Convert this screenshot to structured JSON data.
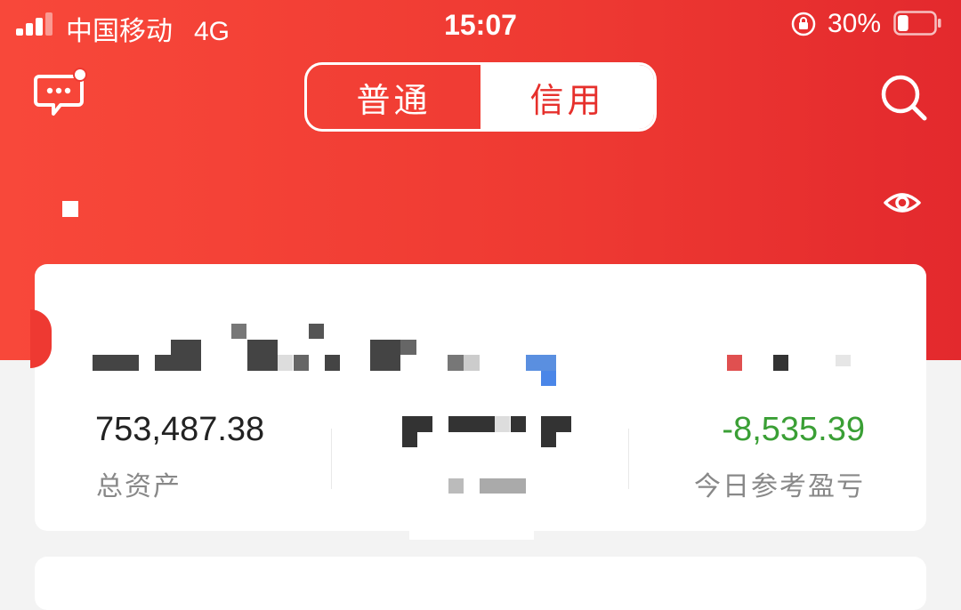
{
  "status_bar": {
    "carrier": "中国移动",
    "network": "4G",
    "time": "15:07",
    "battery_percent": "30%",
    "battery_level": 0.3,
    "icons": [
      "signal-icon",
      "orientation-lock-icon",
      "battery-icon"
    ]
  },
  "nav": {
    "tabs": [
      {
        "label": "普通",
        "selected": false
      },
      {
        "label": "信用",
        "selected": true
      }
    ],
    "left_icon": "message-icon",
    "right_icon": "search-icon",
    "eye_icon": "eye-icon"
  },
  "summary": {
    "total_assets": {
      "value": "753,487.38",
      "label": "总资产"
    },
    "daily_pnl": {
      "value": "-8,535.39",
      "label": "今日参考盈亏"
    }
  },
  "colors": {
    "brand_red": "#ee3932",
    "loss_green": "#3a9f35",
    "background": "#f3f3f3"
  }
}
